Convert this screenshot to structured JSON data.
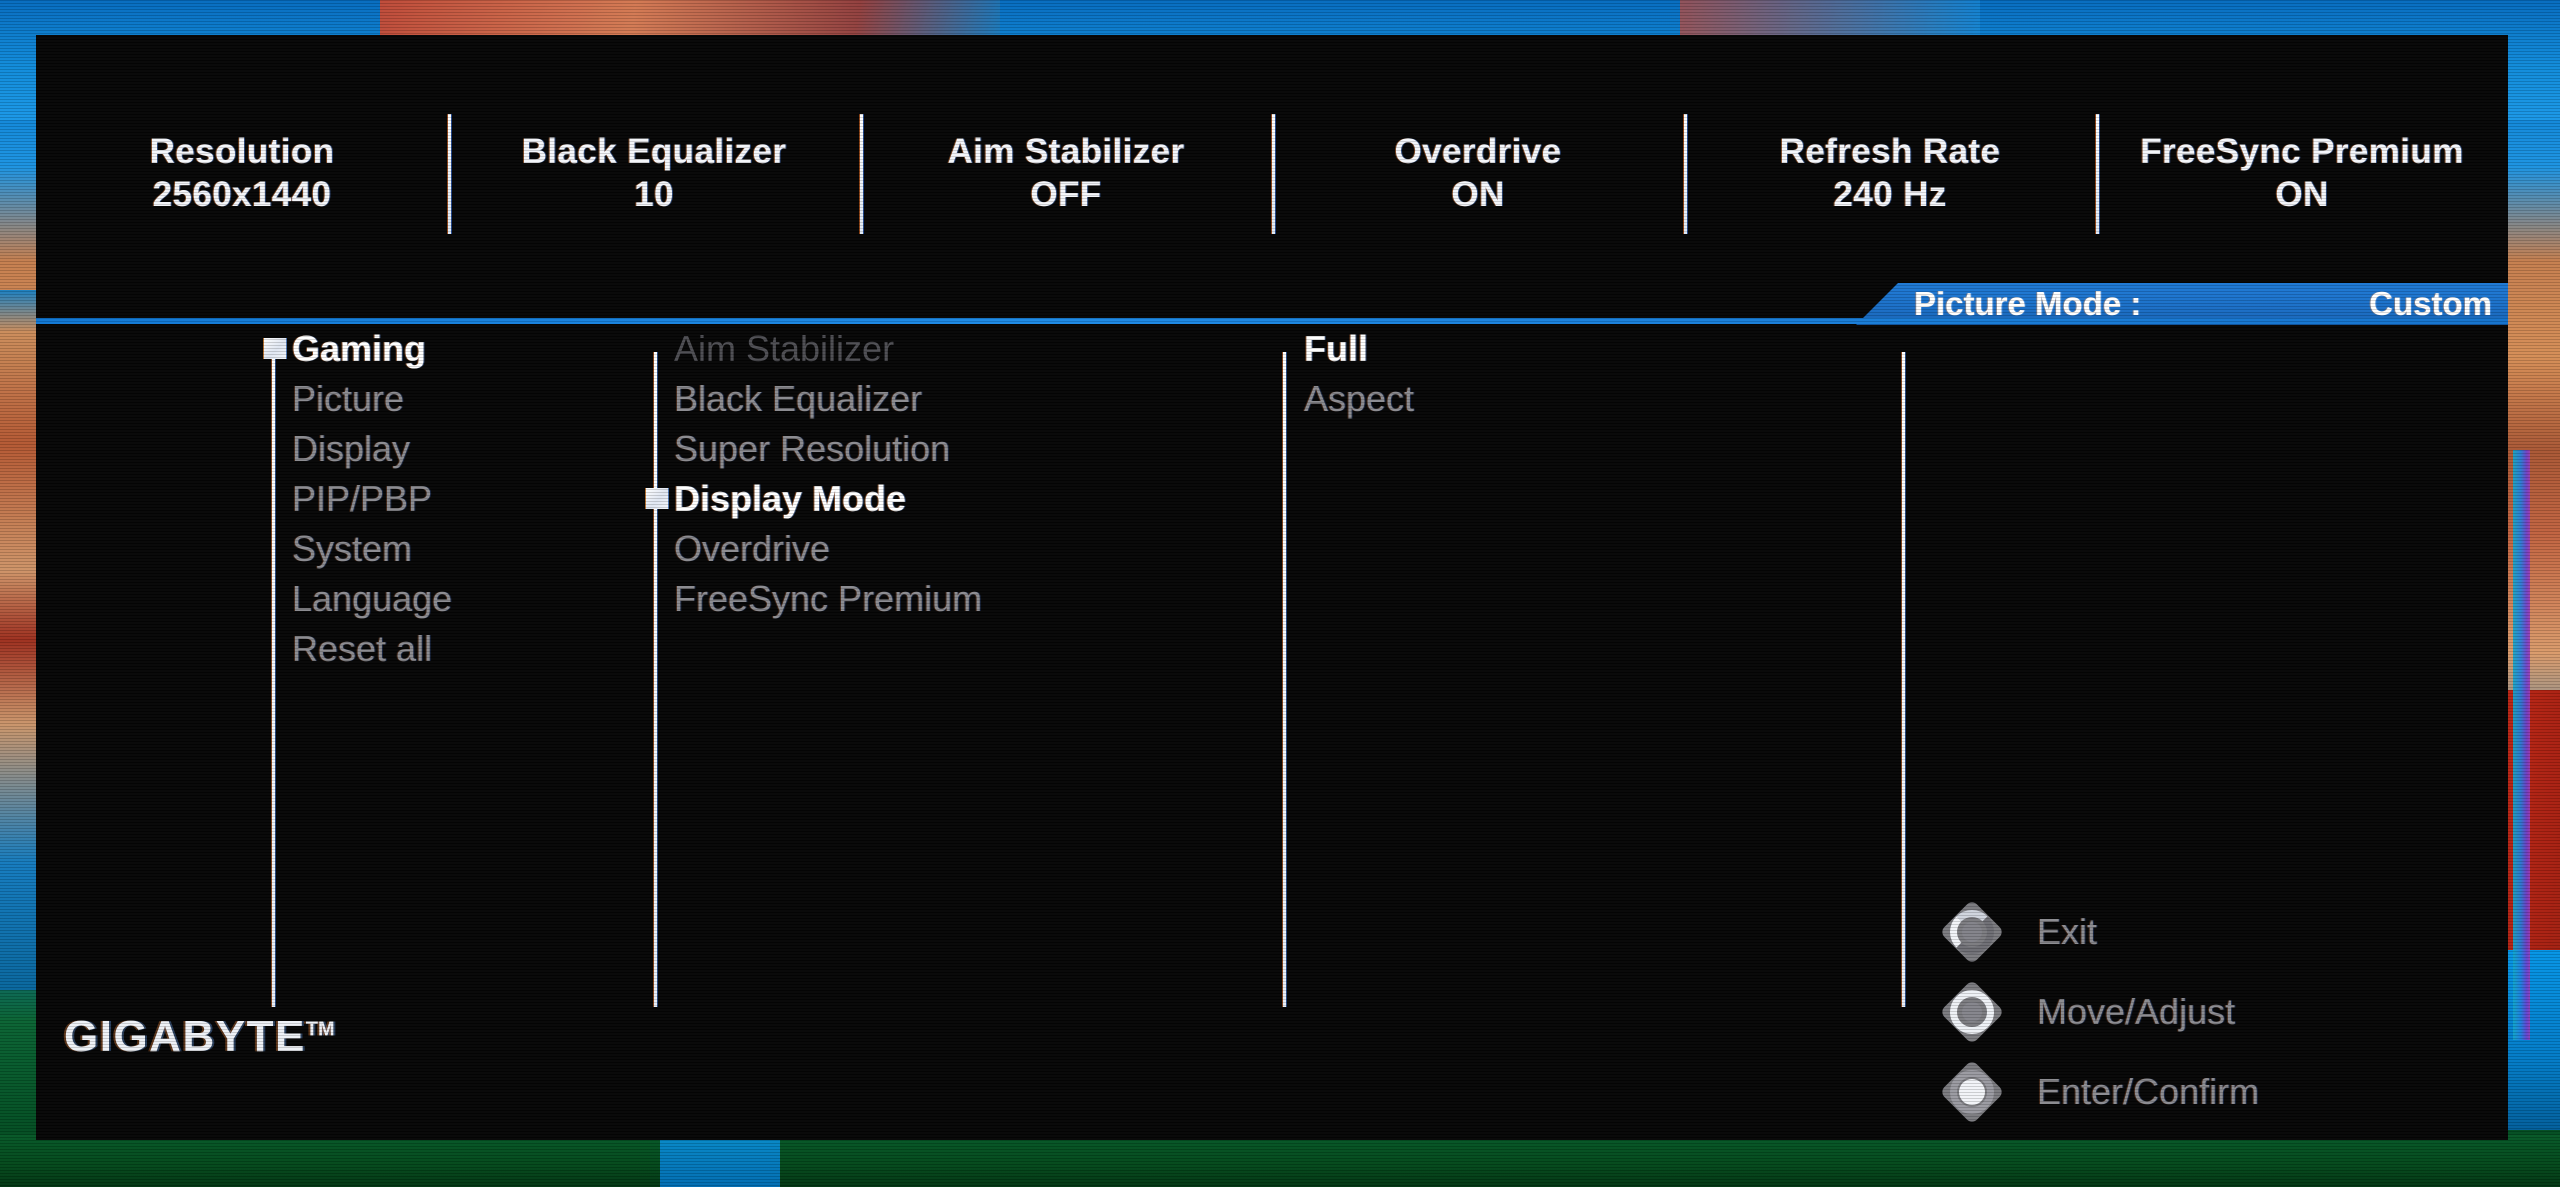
{
  "status_bar": {
    "items": [
      {
        "label": "Resolution",
        "value": "2560x1440"
      },
      {
        "label": "Black Equalizer",
        "value": "10"
      },
      {
        "label": "Aim Stabilizer",
        "value": "OFF"
      },
      {
        "label": "Overdrive",
        "value": "ON"
      },
      {
        "label": "Refresh Rate",
        "value": "240 Hz"
      },
      {
        "label": "FreeSync Premium",
        "value": "ON"
      }
    ]
  },
  "picture_mode": {
    "label": "Picture Mode  :",
    "value": "Custom",
    "accent_color": "#1a6fc8"
  },
  "menu": {
    "column1": {
      "items": [
        {
          "label": "Gaming",
          "state": "selected"
        },
        {
          "label": "Picture",
          "state": "normal"
        },
        {
          "label": "Display",
          "state": "normal"
        },
        {
          "label": "PIP/PBP",
          "state": "normal"
        },
        {
          "label": "System",
          "state": "normal"
        },
        {
          "label": "Language",
          "state": "normal"
        },
        {
          "label": "Reset all",
          "state": "normal"
        }
      ]
    },
    "column2": {
      "items": [
        {
          "label": "Aim Stabilizer",
          "state": "disabled"
        },
        {
          "label": "Black Equalizer",
          "state": "normal"
        },
        {
          "label": "Super Resolution",
          "state": "normal"
        },
        {
          "label": "Display Mode",
          "state": "selected"
        },
        {
          "label": "Overdrive",
          "state": "normal"
        },
        {
          "label": "FreeSync Premium",
          "state": "normal"
        }
      ]
    },
    "column3": {
      "items": [
        {
          "label": "Full",
          "state": "selected"
        },
        {
          "label": "Aspect",
          "state": "normal"
        }
      ]
    }
  },
  "legend": {
    "rows": [
      {
        "icon": "joystick-exit-icon",
        "label": "Exit"
      },
      {
        "icon": "joystick-move-icon",
        "label": "Move/Adjust"
      },
      {
        "icon": "joystick-confirm-icon",
        "label": "Enter/Confirm"
      }
    ]
  },
  "brand": {
    "name": "GIGABYTE",
    "trademark": "TM"
  }
}
